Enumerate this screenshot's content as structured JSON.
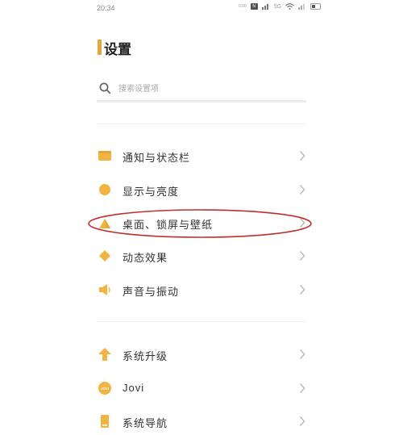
{
  "status_bar": {
    "time": "20:34",
    "icons": [
      "data-speed-text",
      "nfc-icon",
      "signal-icon",
      "wifi-icon",
      "signal-2-icon",
      "battery-icon"
    ],
    "speed_text": "0.00",
    "network_label": "5G"
  },
  "header": {
    "title": "设置"
  },
  "search": {
    "placeholder": "搜索设置项"
  },
  "sections": [
    {
      "items": [
        {
          "label": "通知与状态栏",
          "icon": "notification-icon"
        },
        {
          "label": "显示与亮度",
          "icon": "brightness-icon"
        },
        {
          "label": "桌面、锁屏与壁纸",
          "icon": "wallpaper-icon",
          "highlighted": true
        },
        {
          "label": "动态效果",
          "icon": "motion-icon"
        },
        {
          "label": "声音与振动",
          "icon": "sound-icon"
        }
      ]
    },
    {
      "items": [
        {
          "label": "系统升级",
          "icon": "upgrade-icon"
        },
        {
          "label": "Jovi",
          "icon": "jovi-icon",
          "icon_text": "JOVI"
        },
        {
          "label": "系统导航",
          "icon": "navigation-icon"
        }
      ]
    }
  ],
  "colors": {
    "accent": "#E7A83A",
    "icon_fill": "#F2B440",
    "highlight_ellipse": "#C0302A",
    "chevron": "#bbbbbb"
  }
}
